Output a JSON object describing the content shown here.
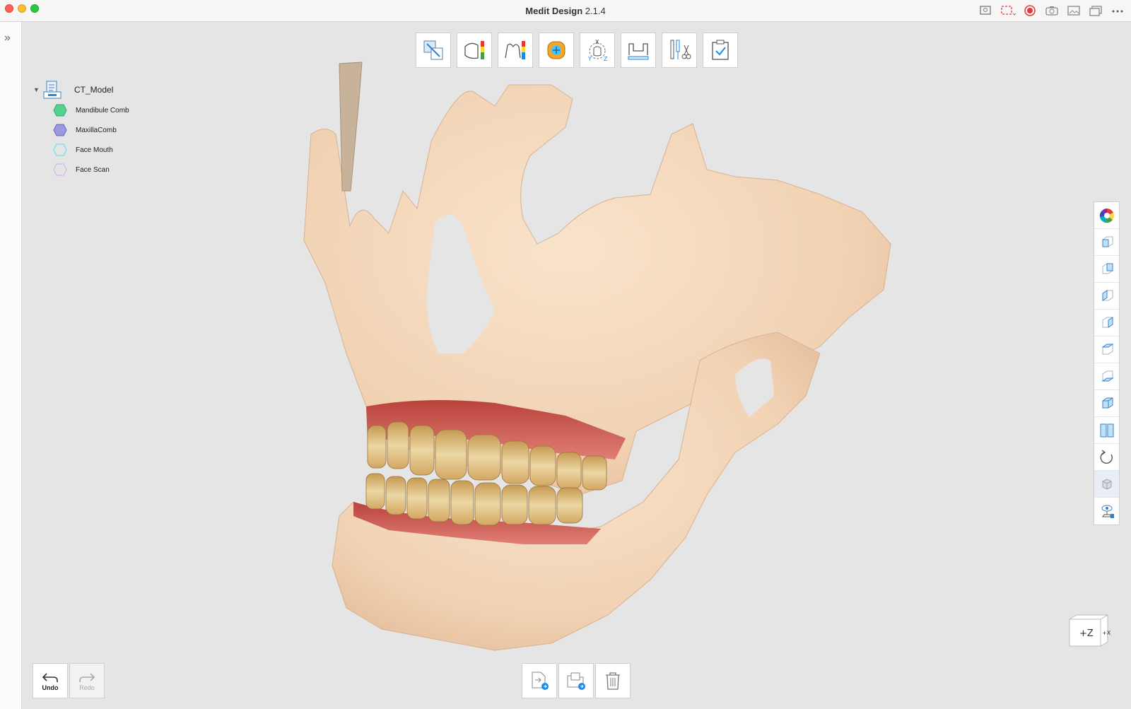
{
  "window": {
    "title_bold": "Medit Design",
    "title_version": "2.1.4"
  },
  "tree": {
    "root_label": "CT_Model",
    "items": [
      {
        "label": "Mandibule Comb",
        "color": "#52d48f",
        "fill": true
      },
      {
        "label": "MaxillaComb",
        "color": "#9b98e0",
        "fill": true
      },
      {
        "label": "Face Mouth",
        "color": "#6fe3f0",
        "fill": false
      },
      {
        "label": "Face Scan",
        "color": "#d8b6f2",
        "fill": false
      }
    ]
  },
  "top_toolbar": {
    "tools": [
      "align-tool-icon",
      "thickness-map-icon",
      "deviation-map-icon",
      "occlusion-map-icon",
      "axis-view-icon",
      "measure-icon",
      "trim-tool-icon",
      "checklist-icon"
    ]
  },
  "right_toolbar": {
    "tools": [
      "color-wheel-icon",
      "view-front-icon",
      "view-back-icon",
      "view-left-icon",
      "view-right-icon",
      "view-top-icon",
      "view-bottom-icon",
      "view-iso-icon",
      "split-view-icon",
      "rotate-icon",
      "solid-render-icon",
      "visibility-icon"
    ]
  },
  "orientation_cube": {
    "face_z": "+Z",
    "face_x": "+X"
  },
  "history": {
    "undo_label": "Undo",
    "redo_label": "Redo"
  },
  "bottom_toolbar": {
    "tools": [
      "export-file-icon",
      "open-folder-icon",
      "delete-icon"
    ]
  },
  "colors": {
    "bone": "#f4d9be",
    "gum": "#cf4d45",
    "tooth": "#e8c27e",
    "accent": "#1e88e5"
  }
}
